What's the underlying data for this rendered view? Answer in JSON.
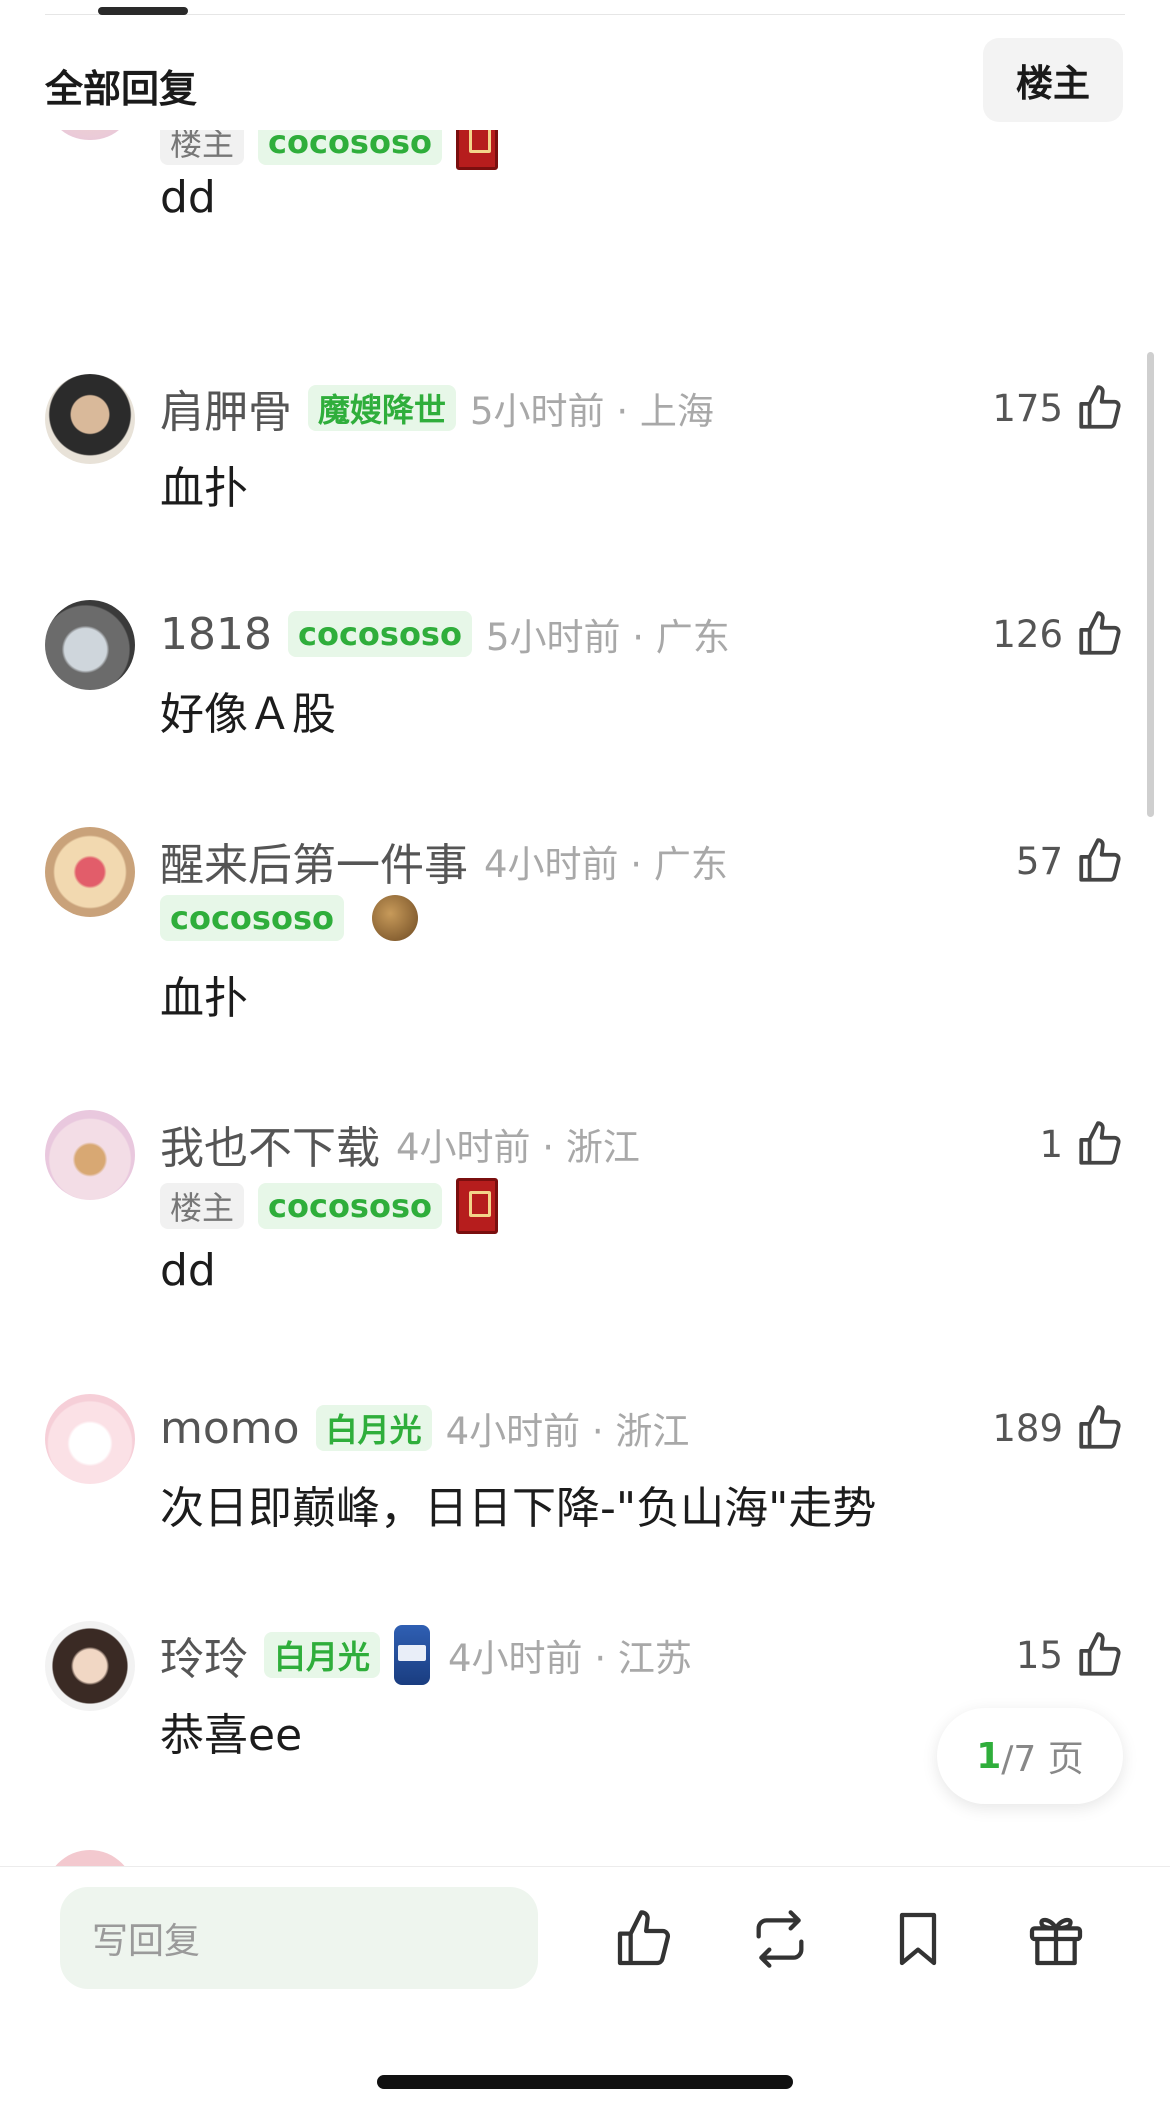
{
  "header": {
    "title": "全部回复",
    "owner_filter": "楼主"
  },
  "comments": [
    {
      "nickname": "",
      "tags": [
        "楼主",
        "cocososo"
      ],
      "text": "dd"
    },
    {
      "nickname": "肩胛骨",
      "tag": "魔嫂降世",
      "meta": "5小时前 · 上海",
      "likes": "175",
      "text": "血扑"
    },
    {
      "nickname": "1818",
      "tag": "cocososo",
      "meta": "5小时前 · 广东",
      "likes": "126",
      "text": "好像Ａ股"
    },
    {
      "nickname": "醒来后第一件事",
      "meta": "4小时前 · 广东",
      "tag": "cocososo",
      "likes": "57",
      "text": "血扑"
    },
    {
      "nickname": "我也不下载",
      "meta": "4小时前 · 浙江",
      "tags": [
        "楼主",
        "cocososo"
      ],
      "likes": "1",
      "text": "dd"
    },
    {
      "nickname": "momo",
      "tag": "白月光",
      "meta": "4小时前 · 浙江",
      "likes": "189",
      "text": "次日即巅峰，日日下降-\"负山海\"走势"
    },
    {
      "nickname": "玲玲",
      "tag": "白月光",
      "meta": "4小时前 · 江苏",
      "likes": "15",
      "text": "恭喜ee"
    }
  ],
  "pager": {
    "current": "1",
    "rest": "/7 页"
  },
  "footer": {
    "reply_placeholder": "写回复"
  },
  "icons": [
    "thumb-up-icon",
    "repost-icon",
    "bookmark-icon",
    "gift-icon"
  ],
  "colors": {
    "accent_green": "#2fae3b",
    "tag_bg": "#e7f7e8"
  }
}
